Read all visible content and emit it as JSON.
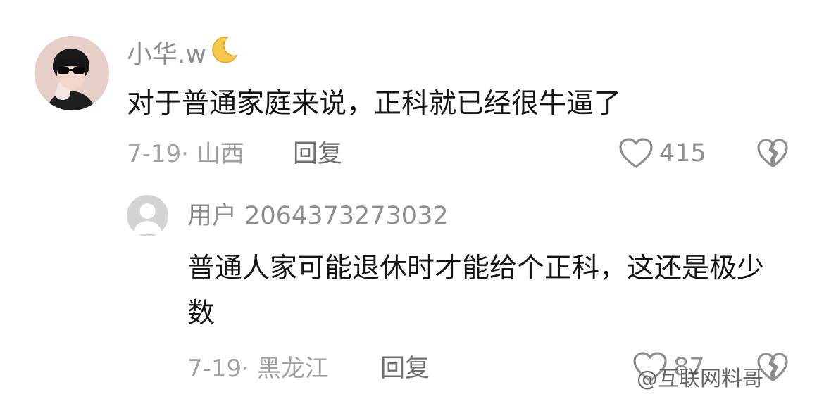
{
  "comment": {
    "username": "小华.w",
    "text": "对于普通家庭来说，正科就已经很牛逼了",
    "meta": "7-19· 山西",
    "reply_label": "回复",
    "like_count": "415"
  },
  "reply": {
    "username": "用户 2064373273032",
    "text": "普通人家可能退休时才能给个正科，这还是极少数",
    "meta": "7-19· 黑龙江",
    "reply_label": "回复",
    "like_count": "87"
  },
  "watermark": {
    "text": "@互联网料哥"
  }
}
